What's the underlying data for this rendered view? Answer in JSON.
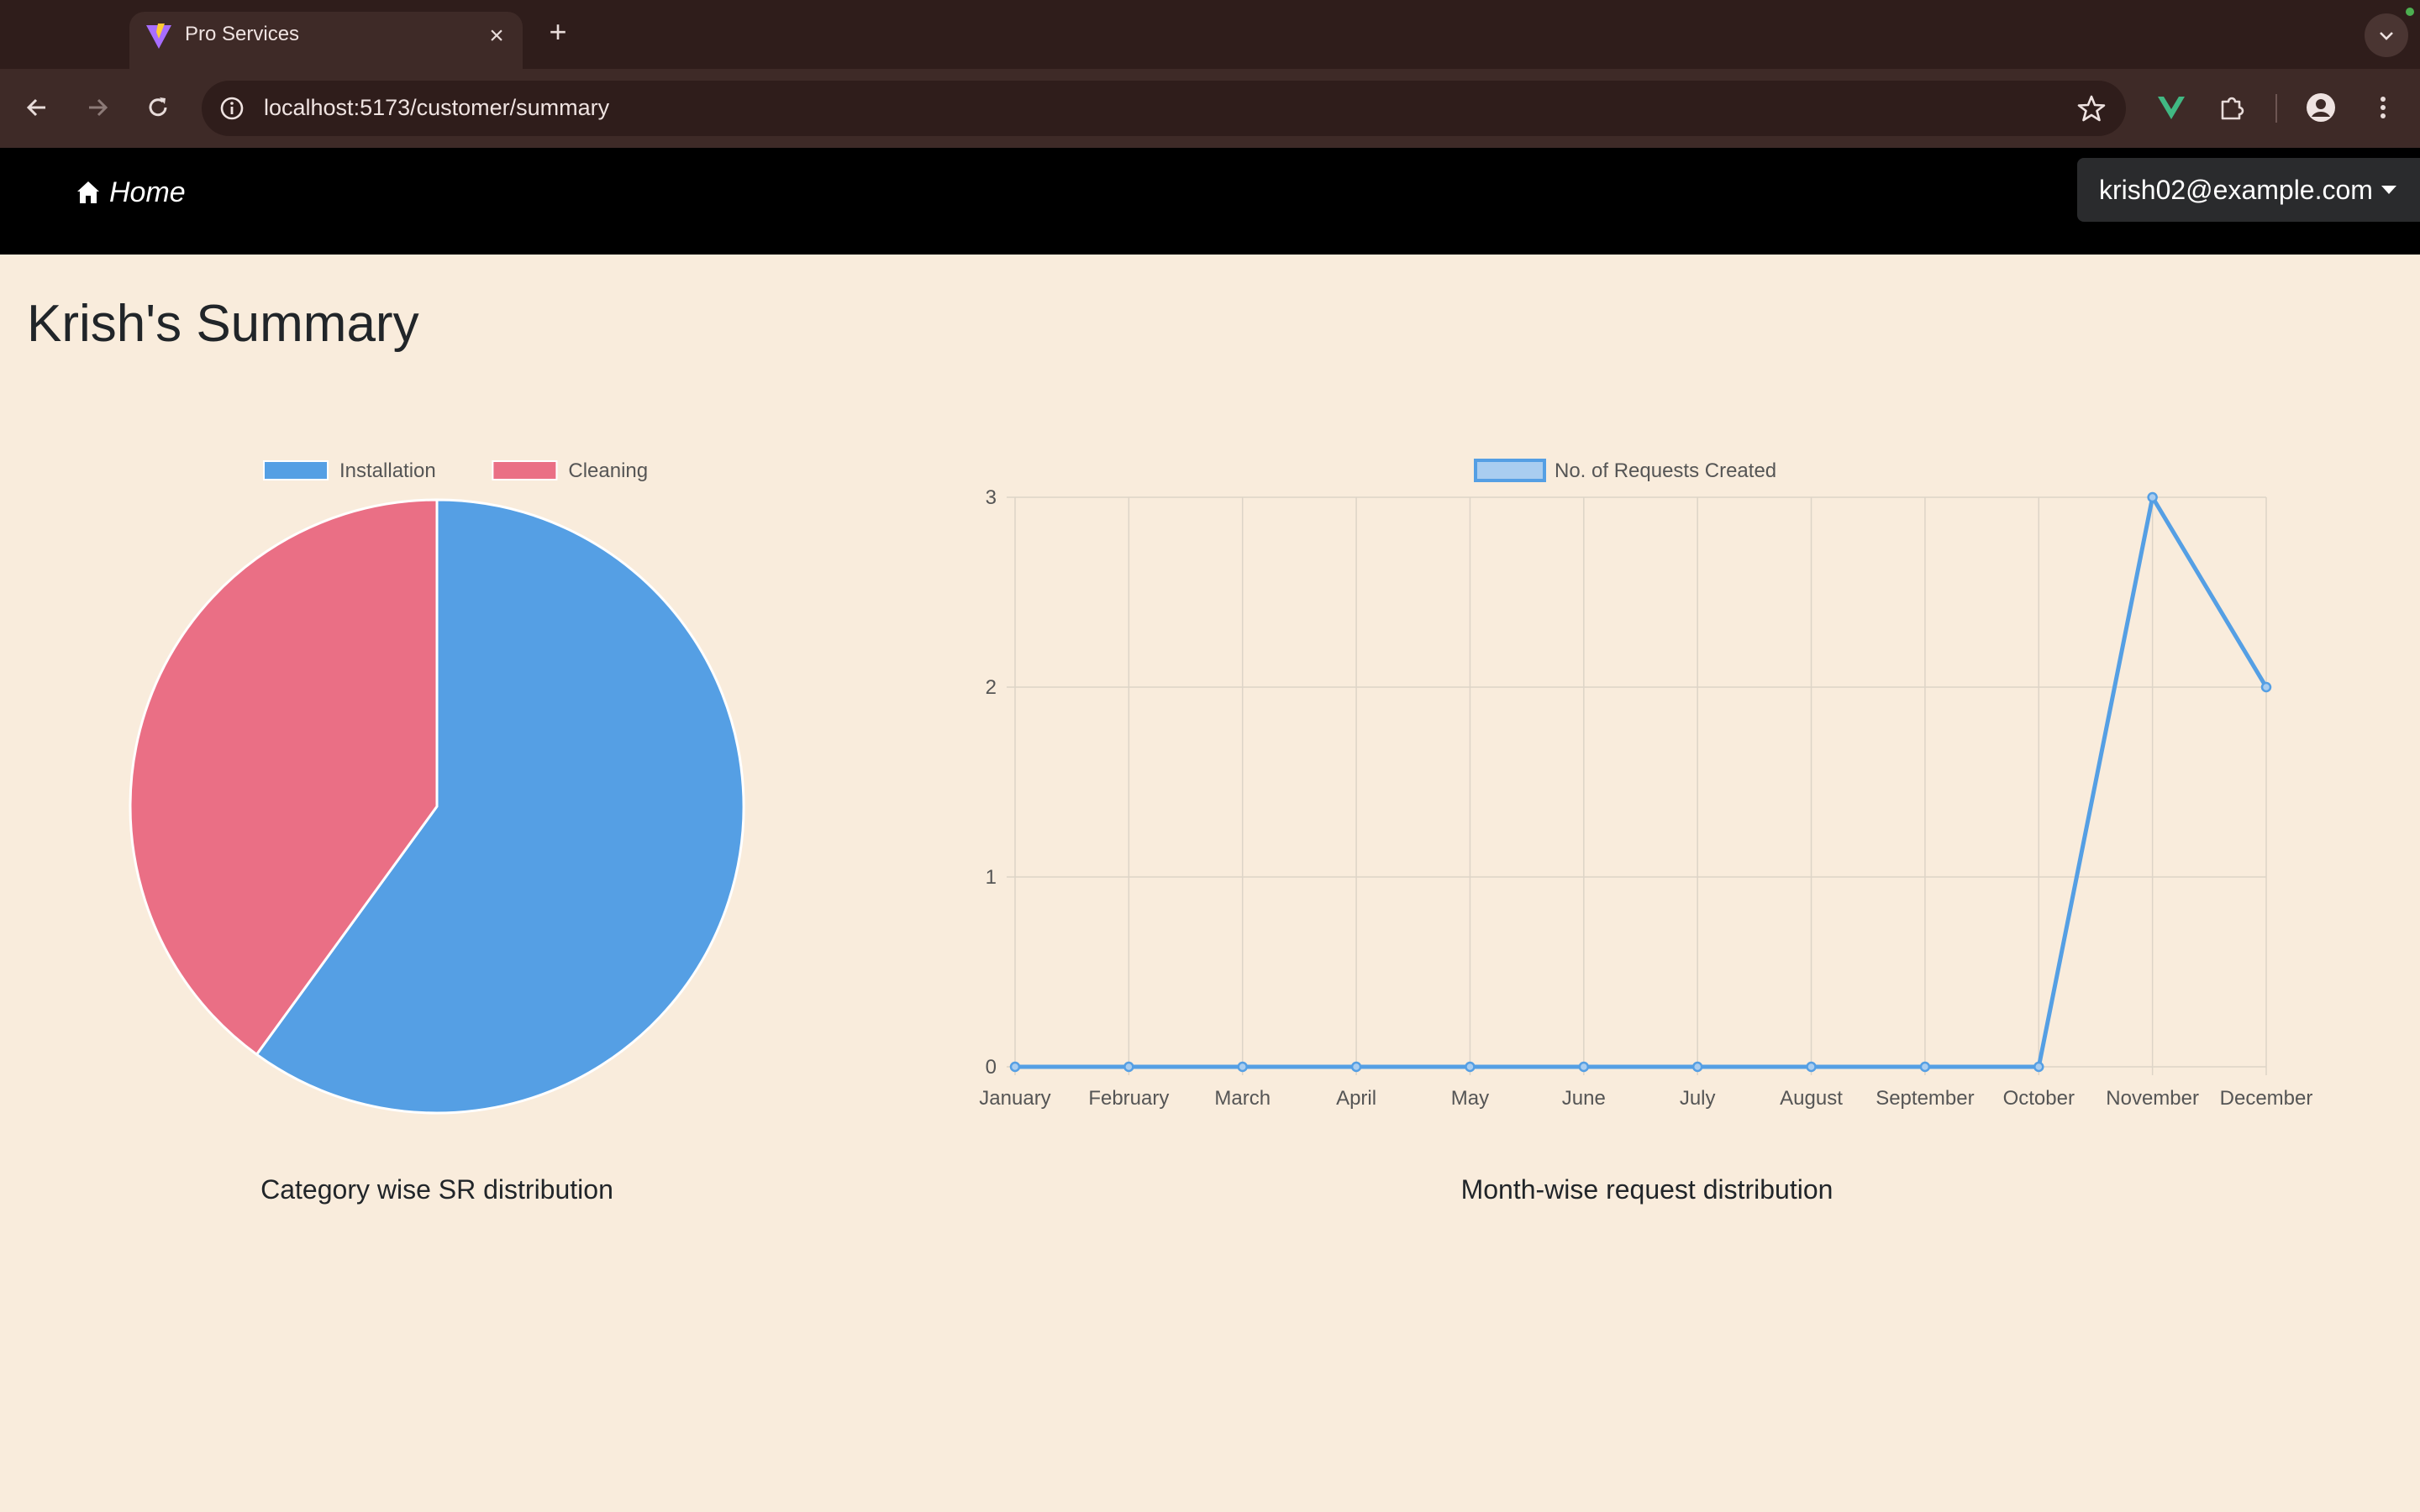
{
  "browser": {
    "tab_title": "Pro Services",
    "tab_close": "×",
    "new_tab": "+",
    "url": "localhost:5173/customer/summary"
  },
  "navbar": {
    "home_label": "Home",
    "user_email": "krish02@example.com"
  },
  "page": {
    "title": "Krish's Summary"
  },
  "colors": {
    "installation": "#559fe4",
    "cleaning": "#ea6f85",
    "background": "#f9ecdc"
  },
  "chart_data": [
    {
      "type": "pie",
      "labels": [
        "Installation",
        "Cleaning"
      ],
      "values": [
        3,
        2
      ],
      "colors": [
        "#559fe4",
        "#ea6f85"
      ],
      "legend_position": "top",
      "caption": "Category wise SR distribution"
    },
    {
      "type": "line",
      "categories": [
        "January",
        "February",
        "March",
        "April",
        "May",
        "June",
        "July",
        "August",
        "September",
        "October",
        "November",
        "December"
      ],
      "series": [
        {
          "name": "No. of Requests Created",
          "values": [
            0,
            0,
            0,
            0,
            0,
            0,
            0,
            0,
            0,
            0,
            3,
            2
          ],
          "color": "#559fe4"
        }
      ],
      "ylim": [
        0,
        3
      ],
      "yticks": [
        0,
        1,
        2,
        3
      ],
      "grid": true,
      "legend_position": "top",
      "caption": "Month-wise request distribution"
    }
  ]
}
